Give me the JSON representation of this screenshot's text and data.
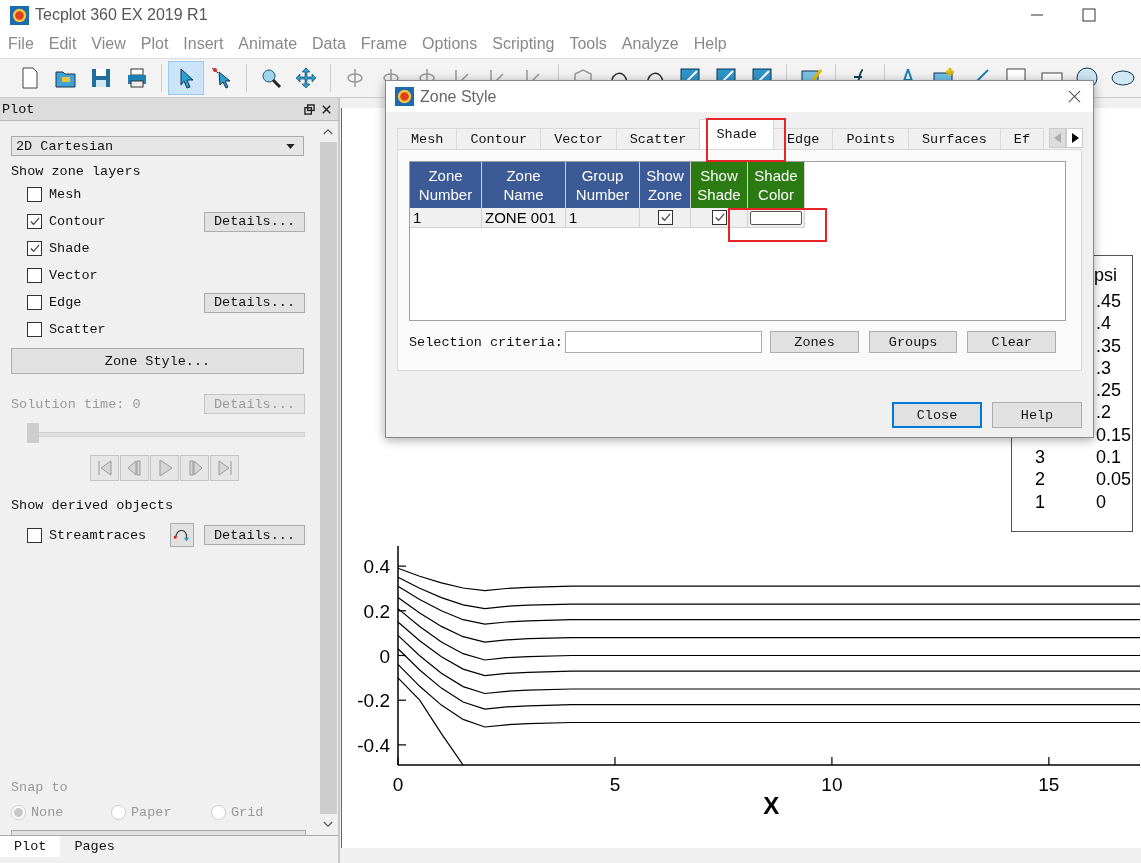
{
  "window": {
    "title": "Tecplot 360 EX 2019 R1"
  },
  "menu": [
    "File",
    "Edit",
    "View",
    "Plot",
    "Insert",
    "Animate",
    "Data",
    "Frame",
    "Options",
    "Scripting",
    "Tools",
    "Analyze",
    "Help"
  ],
  "sidebar": {
    "title": "Plot",
    "plot_type": "2D Cartesian",
    "layers_heading": "Show zone layers",
    "layers": [
      {
        "label": "Mesh",
        "checked": false
      },
      {
        "label": "Contour",
        "checked": true,
        "details": "Details..."
      },
      {
        "label": "Shade",
        "checked": true
      },
      {
        "label": "Vector",
        "checked": false
      },
      {
        "label": "Edge",
        "checked": false,
        "details": "Details..."
      },
      {
        "label": "Scatter",
        "checked": false
      }
    ],
    "zone_style_button": "Zone Style...",
    "solution_time": {
      "label": "Solution time: 0",
      "details": "Details...",
      "disabled": true,
      "level": 0
    },
    "derived_heading": "Show derived objects",
    "derived": [
      {
        "label": "Streamtraces",
        "checked": false,
        "details": "Details..."
      }
    ],
    "snap": {
      "label": "Snap to",
      "disabled": true,
      "options": [
        {
          "label": "None",
          "selected": true
        },
        {
          "label": "Paper",
          "selected": false
        },
        {
          "label": "Grid",
          "selected": false
        }
      ]
    },
    "tabs": [
      {
        "label": "Plot",
        "selected": true
      },
      {
        "label": "Pages",
        "selected": false
      }
    ]
  },
  "plot": {
    "chart_data": {
      "type": "line",
      "xlabel": "X",
      "x": [
        0,
        0.5,
        1,
        1.5,
        2,
        2.5,
        3,
        4,
        10,
        17.1
      ],
      "series": [
        {
          "color": "#000000",
          "values": [
            0.39,
            0.355,
            0.325,
            0.302,
            0.29,
            0.3,
            0.305,
            0.31,
            0.31,
            0.31
          ]
        },
        {
          "color": "#000000",
          "values": [
            0.35,
            0.301,
            0.259,
            0.227,
            0.21,
            0.22,
            0.225,
            0.23,
            0.23,
            0.23
          ]
        },
        {
          "color": "#000000",
          "values": [
            0.31,
            0.25,
            0.2,
            0.16,
            0.14,
            0.15,
            0.155,
            0.16,
            0.16,
            0.16
          ]
        },
        {
          "color": "#000000",
          "values": [
            0.26,
            0.19,
            0.13,
            0.084,
            0.06,
            0.07,
            0.075,
            0.08,
            0.08,
            0.08
          ]
        },
        {
          "color": "#000000",
          "values": [
            0.21,
            0.13,
            0.06,
            0.008,
            -0.02,
            -0.01,
            -0.005,
            0,
            0,
            0
          ]
        },
        {
          "color": "#000000",
          "values": [
            0.15,
            0.066,
            -0.006,
            -0.061,
            -0.09,
            -0.08,
            -0.075,
            -0.07,
            -0.07,
            -0.07
          ]
        },
        {
          "color": "#000000",
          "values": [
            0.09,
            -0.001,
            -0.079,
            -0.139,
            -0.17,
            -0.16,
            -0.155,
            -0.15,
            -0.15,
            -0.15
          ]
        },
        {
          "color": "#000000",
          "values": [
            0.03,
            -0.065,
            -0.146,
            -0.208,
            -0.24,
            -0.23,
            -0.225,
            -0.22,
            -0.22,
            -0.22
          ]
        },
        {
          "color": "#000000",
          "values": [
            -0.04,
            -0.138,
            -0.222,
            -0.286,
            -0.32,
            -0.31,
            -0.305,
            -0.3,
            -0.3,
            -0.3
          ]
        },
        {
          "color": "#000000",
          "values": [
            -0.1,
            -0.2,
            -0.35,
            -0.49,
            null,
            null,
            null,
            null,
            null,
            null
          ]
        }
      ],
      "xlim": [
        0,
        17.1
      ],
      "ylim": [
        -0.49,
        0.49
      ],
      "xticks": [
        0,
        5,
        10,
        15
      ],
      "yticks": [
        -0.4,
        -0.2,
        0,
        0.2,
        0.4
      ]
    },
    "legend": {
      "title": "psi",
      "rows": [
        {
          "value": ".45"
        },
        {
          "value": ".4"
        },
        {
          "value": ".35"
        },
        {
          "value": ".3"
        },
        {
          "value": ".25"
        },
        {
          "value": ".2"
        },
        {
          "value": "0.15"
        },
        {
          "number": "3",
          "value": "0.1"
        },
        {
          "number": "2",
          "value": "0.05"
        },
        {
          "number": "1",
          "value": "0"
        }
      ]
    }
  },
  "dialog": {
    "title": "Zone Style",
    "tabs": [
      {
        "label": "Mesh",
        "selected": false
      },
      {
        "label": "Contour",
        "selected": false
      },
      {
        "label": "Vector",
        "selected": false
      },
      {
        "label": "Scatter",
        "selected": false
      },
      {
        "label": "Shade",
        "selected": true
      },
      {
        "label": "Edge",
        "selected": false
      },
      {
        "label": "Points",
        "selected": false
      },
      {
        "label": "Surfaces",
        "selected": false
      },
      {
        "label": "Ef",
        "selected": false
      }
    ],
    "table": {
      "columns": [
        {
          "label": "Zone Number",
          "color": "#3c5a96"
        },
        {
          "label": "Zone Name",
          "color": "#3c5a96"
        },
        {
          "label": "Group Number",
          "color": "#3c5a96"
        },
        {
          "label": "Show Zone",
          "color": "#3c5a96"
        },
        {
          "label": "Show Shade",
          "color": "#2b7a12"
        },
        {
          "label": "Shade Color",
          "color": "#2b7a12"
        }
      ],
      "rows": [
        {
          "cells": [
            {
              "kind": "text",
              "text": "1"
            },
            {
              "kind": "text",
              "text": "ZONE 001"
            },
            {
              "kind": "text",
              "text": "1"
            },
            {
              "kind": "check",
              "checked": true
            },
            {
              "kind": "check",
              "checked": true
            },
            {
              "kind": "swatch",
              "color": "#ffffff"
            }
          ]
        }
      ]
    },
    "selection": {
      "label": "Selection criteria:",
      "buttons": [
        "Zones",
        "Groups",
        "Clear"
      ]
    },
    "buttons": [
      {
        "label": "Close",
        "focused": true
      },
      {
        "label": "Help",
        "focused": false
      }
    ]
  }
}
